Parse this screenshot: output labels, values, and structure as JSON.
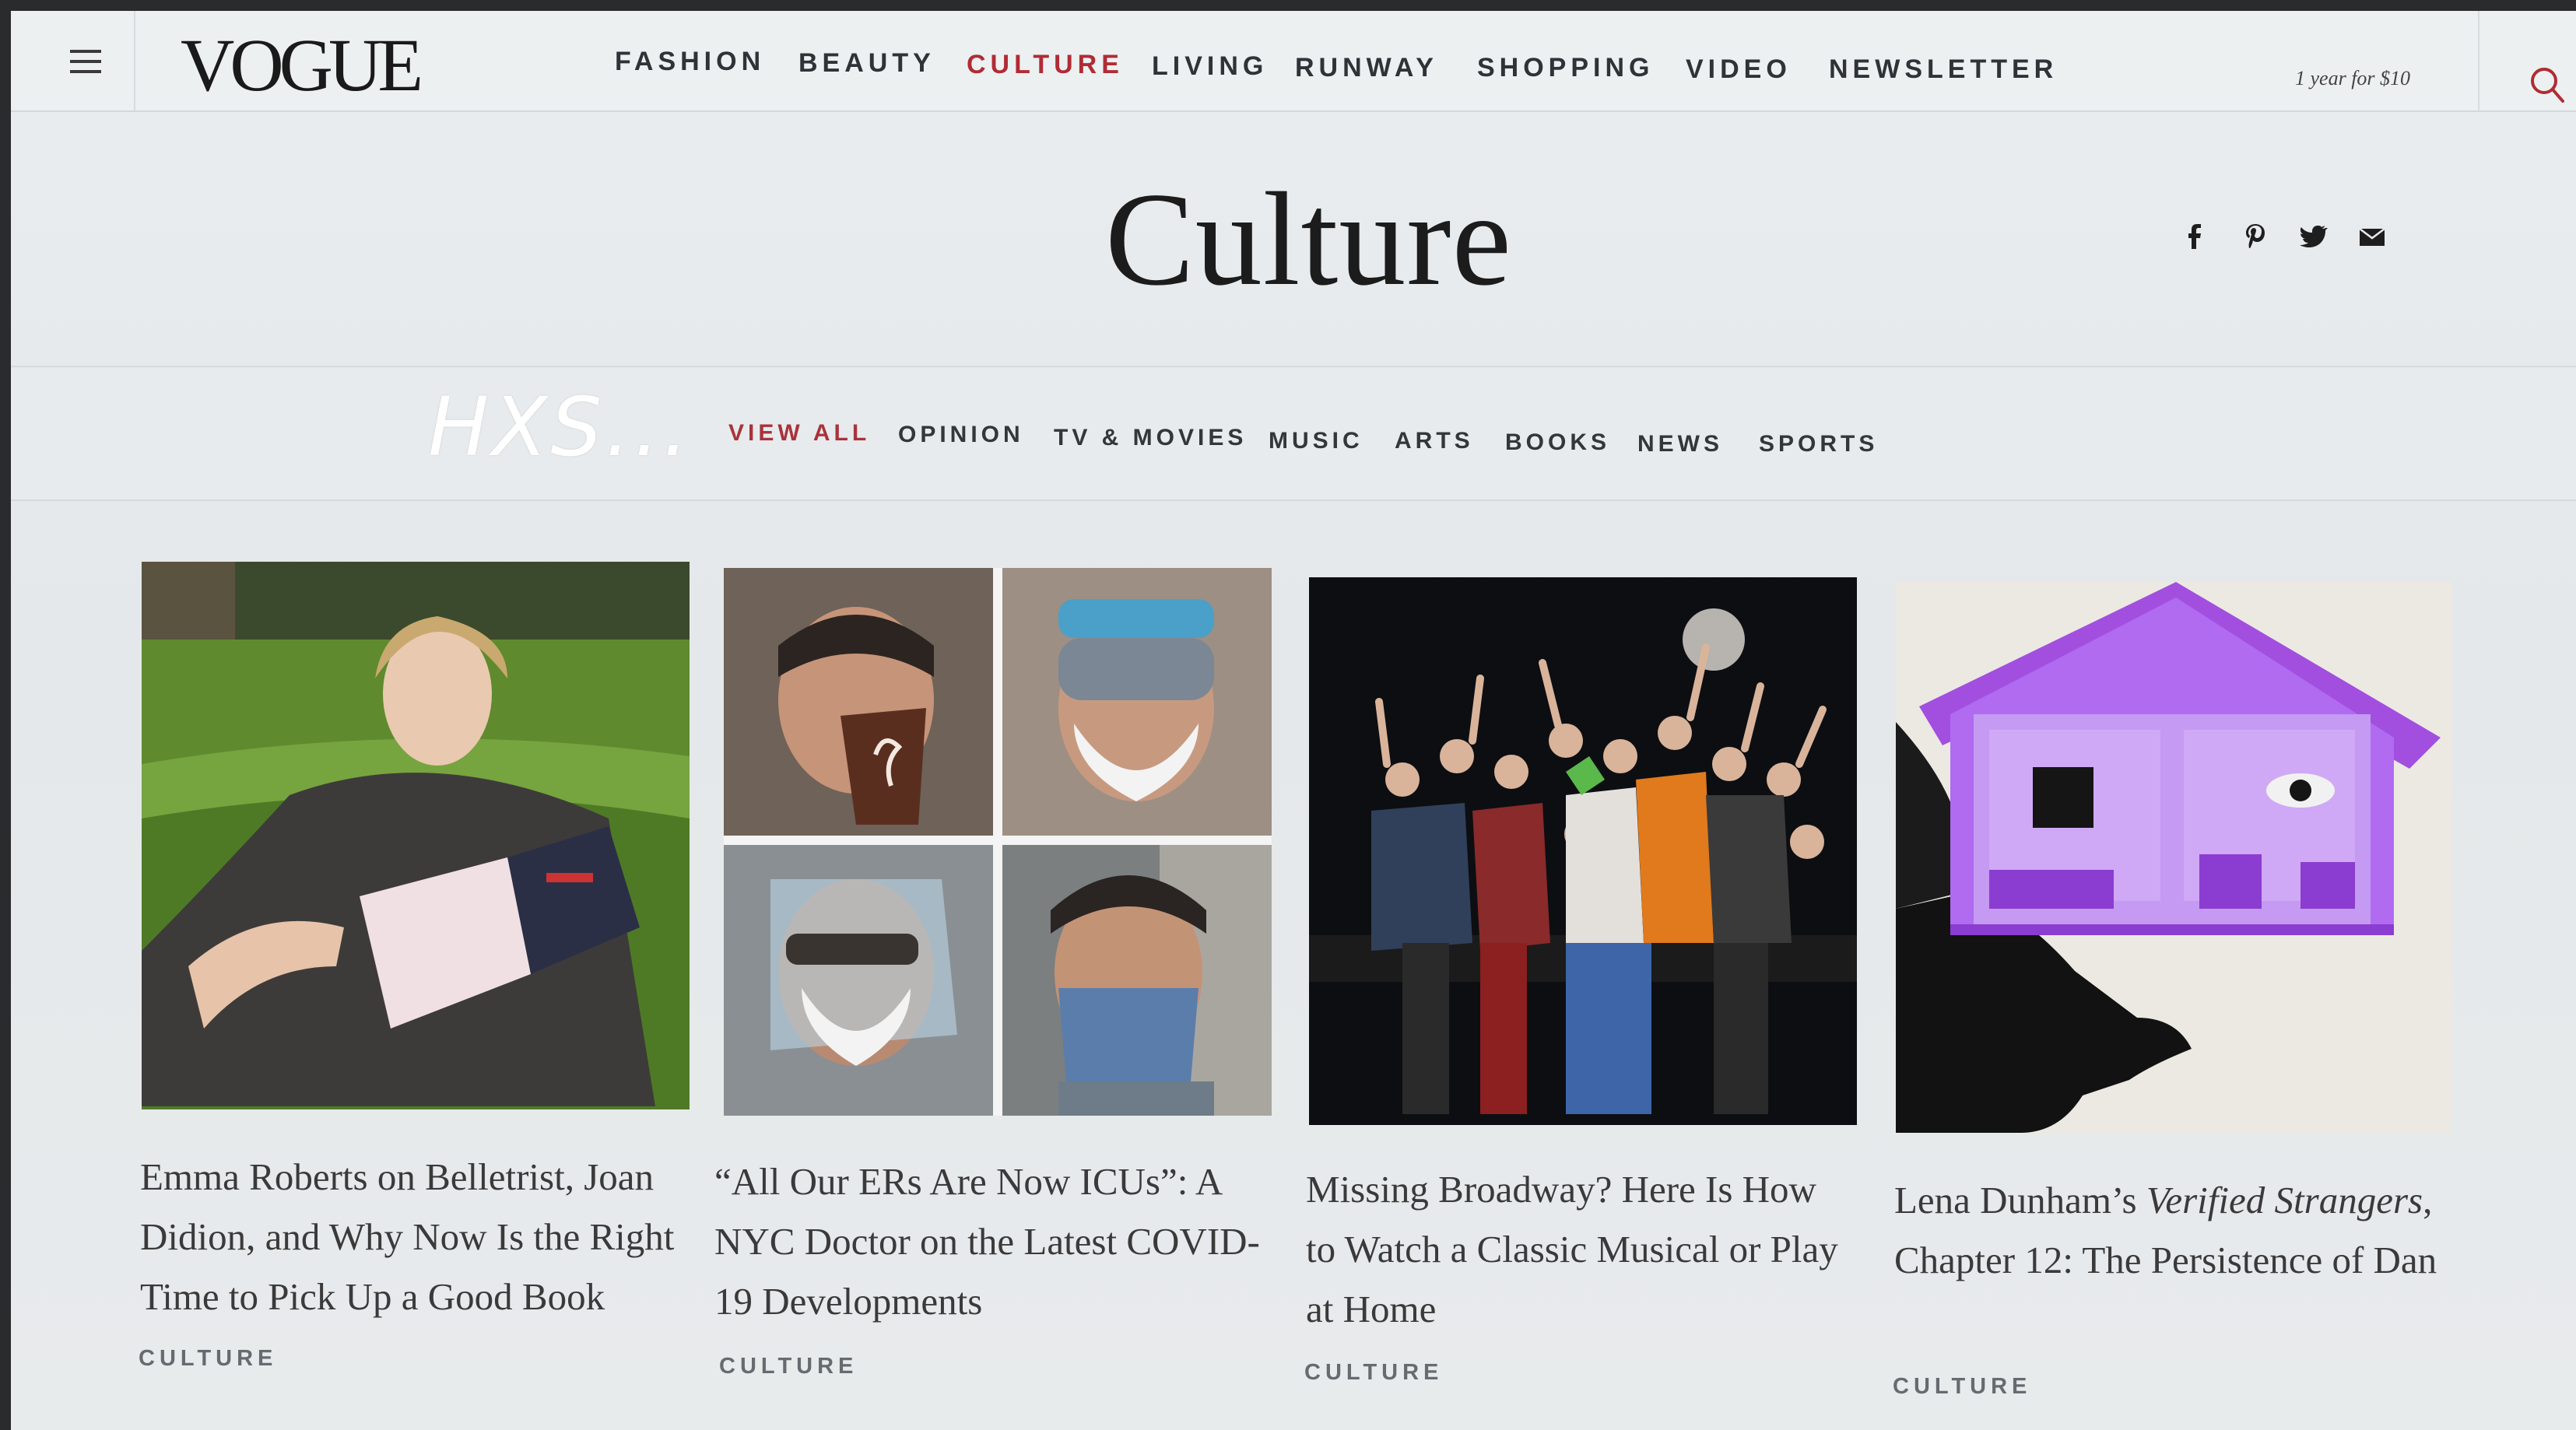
{
  "nav": {
    "logo": "VOGUE",
    "items": [
      {
        "label": "FASHION",
        "active": false
      },
      {
        "label": "BEAUTY",
        "active": false
      },
      {
        "label": "CULTURE",
        "active": true
      },
      {
        "label": "LIVING",
        "active": false
      },
      {
        "label": "RUNWAY",
        "active": false
      },
      {
        "label": "SHOPPING",
        "active": false
      },
      {
        "label": "VIDEO",
        "active": false
      },
      {
        "label": "NEWSLETTER",
        "active": false
      }
    ],
    "promo": "1 year for $10",
    "search_icon": "search-icon",
    "menu_icon": "hamburger-icon"
  },
  "header": {
    "title": "Culture",
    "social": [
      "facebook-icon",
      "pinterest-icon",
      "twitter-icon",
      "email-icon"
    ]
  },
  "watermark": "HXS...",
  "subnav": {
    "items": [
      {
        "label": "VIEW ALL",
        "active": true
      },
      {
        "label": "OPINION",
        "active": false
      },
      {
        "label": "TV & MOVIES",
        "active": false
      },
      {
        "label": "MUSIC",
        "active": false
      },
      {
        "label": "ARTS",
        "active": false
      },
      {
        "label": "BOOKS",
        "active": false
      },
      {
        "label": "NEWS",
        "active": false
      },
      {
        "label": "SPORTS",
        "active": false
      }
    ]
  },
  "articles": [
    {
      "title": "Emma Roberts on Belletrist, Joan Didion, and Why Now Is the Right Time to Pick Up a Good Book",
      "category": "CULTURE",
      "image": "woman-reading-on-grass-photo"
    },
    {
      "title": "“All Our ERs Are Now ICUs”: A NYC Doctor on the Latest COVID-19 Developments",
      "category": "CULTURE",
      "image": "doctor-masks-collage-photo"
    },
    {
      "title": "Missing Broadway? Here Is How to Watch a Classic Musical or Play at Home",
      "category": "CULTURE",
      "image": "broadway-cast-stage-photo"
    },
    {
      "title_plain_1": "Lena Dunham’s ",
      "title_italic": "Verified Strangers",
      "title_plain_2": ", Chapter 12: The Persistence of Dan",
      "category": "CULTURE",
      "image": "purple-house-silhouette-illustration"
    }
  ],
  "colors": {
    "accent": "#b02c35",
    "text": "#2f3236",
    "background": "#e6eaec",
    "purple": "#9b3fd6"
  }
}
